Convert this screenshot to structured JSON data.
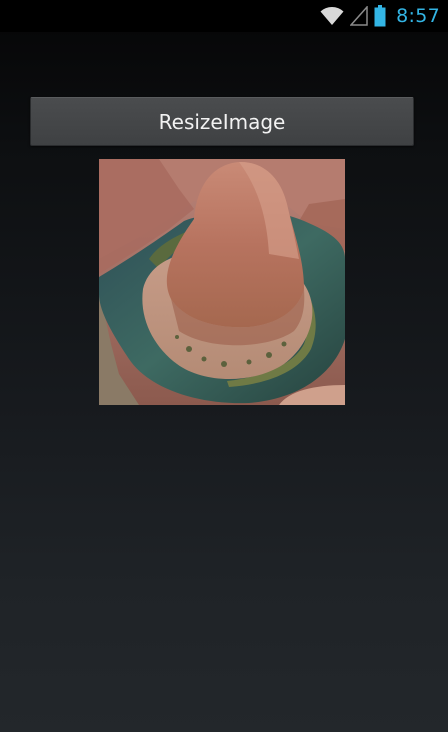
{
  "status_bar": {
    "time": "8:57",
    "icons": [
      "wifi-icon",
      "signal-icon",
      "battery-icon"
    ],
    "accent_color": "#33b5e5"
  },
  "main": {
    "button_label": "ResizeImage",
    "image": {
      "subject": "horseshoe-bend-canyon-photo"
    }
  }
}
